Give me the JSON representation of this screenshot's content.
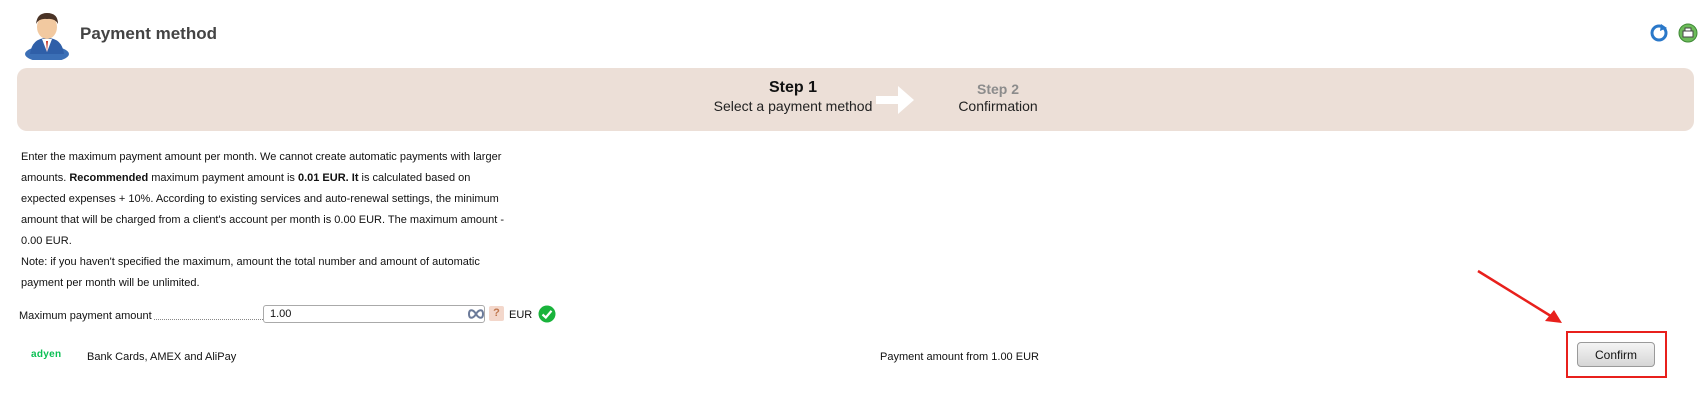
{
  "header": {
    "title": "Payment method",
    "avatar_icon": "user-avatar-icon",
    "refresh_icon": "refresh-icon",
    "print_icon": "print-icon"
  },
  "steps": {
    "step1_title": "Step 1",
    "step1_subtitle": "Select a payment method",
    "step2_title": "Step 2",
    "step2_subtitle": "Confirmation",
    "bar_color": "#ecdfd7"
  },
  "description": {
    "p1": "Enter the maximum payment amount per month. We cannot create automatic payments with larger amounts. ",
    "recommended_label": "Recommended",
    "p2": " maximum payment amount is ",
    "recommended_value": "0.01 EUR",
    "p3": ". It",
    "p4": " is calculated based on expected expenses + 10%. According to existing services and auto-renewal settings, the minimum amount that will be charged from a client's account per month is 0.00 EUR. The maximum amount - 0.00 EUR.",
    "note": "Note: if you haven't specified the maximum, amount the total number and amount of automatic payment per month will be unlimited."
  },
  "amount": {
    "label": "Maximum payment amount",
    "value": "1.00",
    "help": "?",
    "currency": "EUR"
  },
  "method": {
    "logo": "adyen",
    "name": "Bank Cards, AMEX and AliPay",
    "payment_from": "Payment amount from 1.00 EUR"
  },
  "confirm_label": "Confirm",
  "colors": {
    "accent_green": "#0abf53",
    "highlight_red": "#e8201c"
  }
}
